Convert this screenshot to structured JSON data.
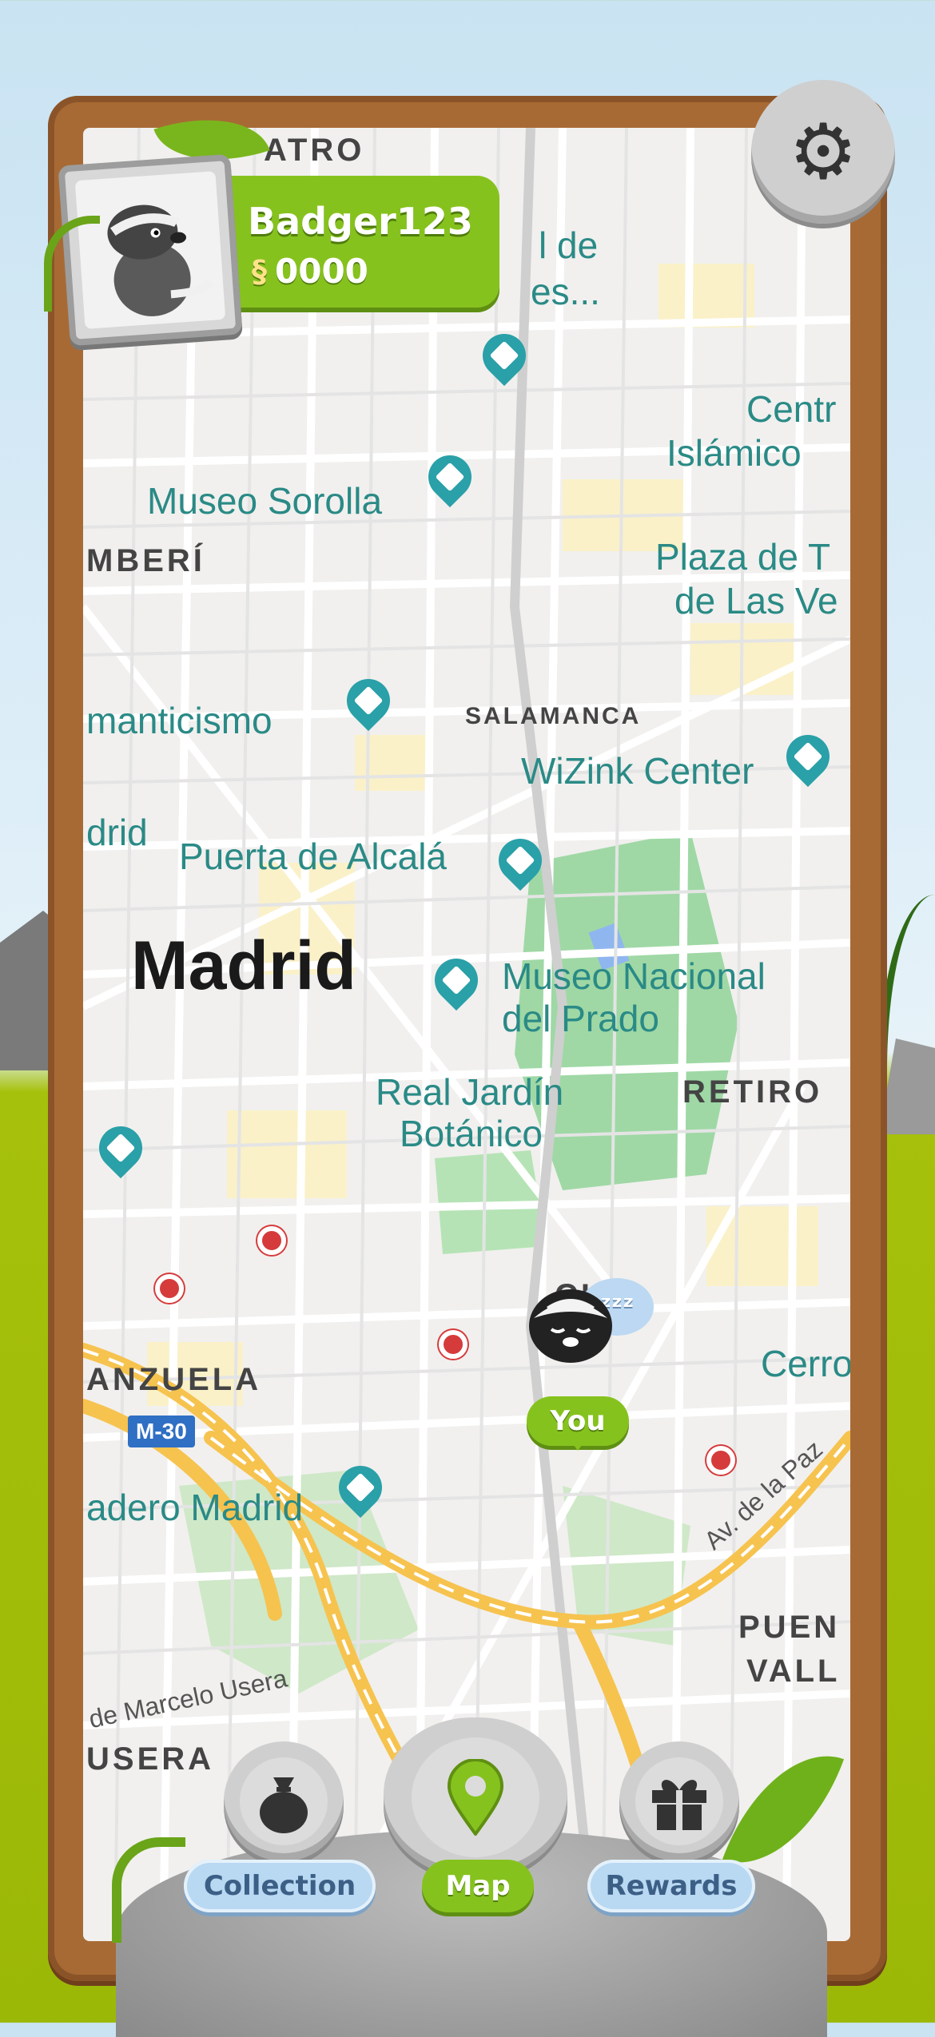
{
  "profile": {
    "username": "Badger123",
    "coins": "0000"
  },
  "map": {
    "labels": {
      "teatro_fragment": "ATRO",
      "palacio_fragment_1": "l de",
      "palacio_fragment_2": "es...",
      "centro_fragment_1": "Centr",
      "centro_fragment_2": "Islámico",
      "museo_sorolla": "Museo Sorolla",
      "chamberi_fragment": "MBERÍ",
      "plaza_fragment_1": "Plaza de T",
      "plaza_fragment_2": "de Las Ve",
      "romanticismo_fragment": "manticismo",
      "salamanca": "SALAMANCA",
      "wizink_center": "WiZink Center",
      "madrid_fragment": "drid",
      "puerta_de_alcala": "Puerta de Alcalá",
      "madrid": "Madrid",
      "museo_prado_1": "Museo Nacional",
      "museo_prado_2": "del Prado",
      "real_jardin_1": "Real Jardín",
      "real_jardin_2": "Botánico",
      "retiro": "RETIRO",
      "atocha_fragment": "CHA",
      "cerro_fragment": "Cerro",
      "arganzuela_fragment": "ANZUELA",
      "m30": "M-30",
      "matadero_fragment": "adero Madrid",
      "av_de_la_paz": "Av. de la Paz",
      "puente_fragment_1": "PUEN",
      "puente_fragment_2": "VALL",
      "marcelo_usera": "de Marcelo Usera",
      "usera_fragment": "USERA"
    },
    "player": {
      "label": "You",
      "status_icon": "zzz"
    }
  },
  "nav": {
    "collection": {
      "label": "Collection",
      "icon": "bag-icon"
    },
    "map": {
      "label": "Map",
      "icon": "location-pin-icon"
    },
    "rewards": {
      "label": "Rewards",
      "icon": "gift-icon"
    }
  },
  "settings": {
    "icon": "gear-icon"
  },
  "colors": {
    "accent_green": "#86c21e",
    "frame_wood": "#a86a34",
    "nav_blue": "#b9d8f2",
    "poi_teal": "#2a8a86",
    "park_green": "#9fd8a5"
  }
}
